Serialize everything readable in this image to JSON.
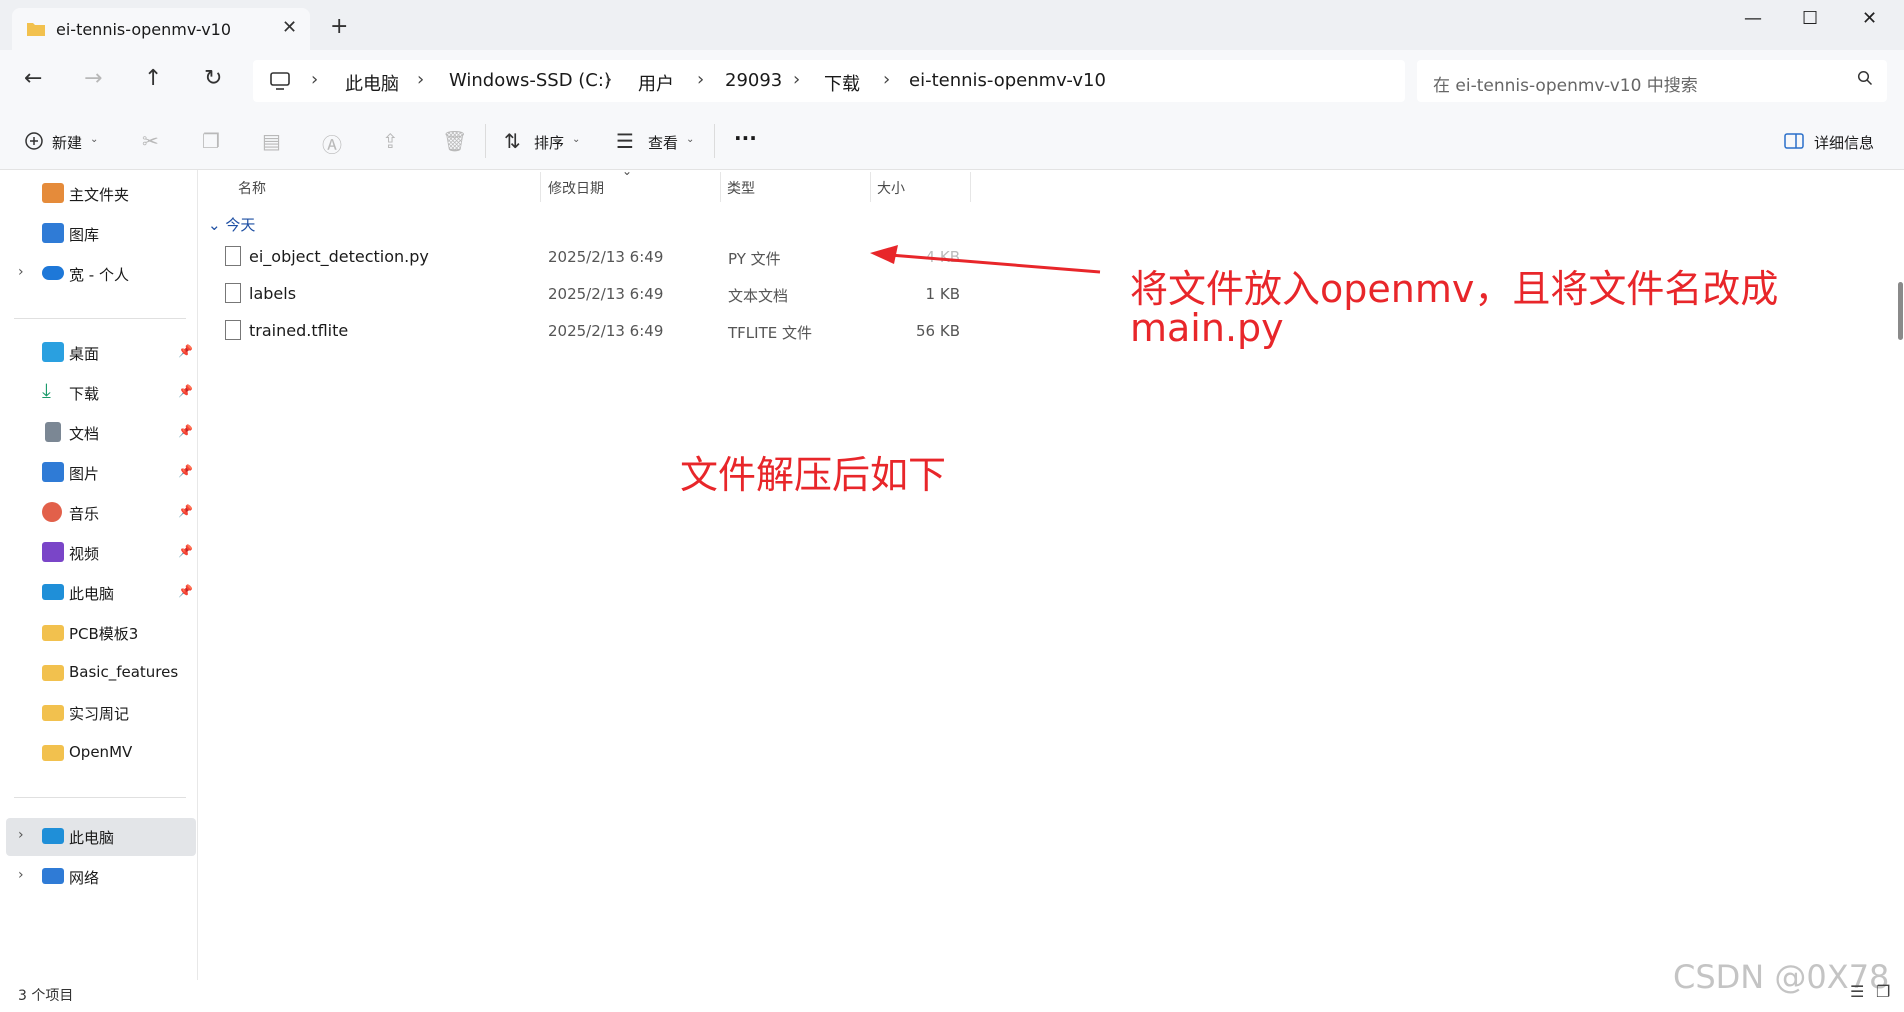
{
  "tab": {
    "title": "ei-tennis-openmv-v10",
    "close": "✕",
    "new": "+"
  },
  "window_controls": {
    "minimize": "—",
    "maximize": "☐",
    "close": "✕"
  },
  "nav": {
    "back": "←",
    "forward": "→",
    "up": "↑",
    "refresh": "↻"
  },
  "breadcrumb": [
    "此电脑",
    "Windows-SSD (C:)",
    "用户",
    "29093",
    "下载",
    "ei-tennis-openmv-v10"
  ],
  "breadcrumb_sep": "›",
  "search": {
    "placeholder": "在 ei-tennis-openmv-v10 中搜索"
  },
  "toolbar": {
    "new_label": "新建",
    "sort_label": "排序",
    "view_label": "查看",
    "more": "···",
    "details_label": "详细信息"
  },
  "sidebar": {
    "top": [
      {
        "label": "主文件夹",
        "icon": "home-icon",
        "color": "#e58b3a"
      },
      {
        "label": "图库",
        "icon": "gallery-icon",
        "color": "#2f7bd6"
      },
      {
        "label": "宽 - 个人",
        "icon": "cloud-icon",
        "color": "#1e78d8"
      }
    ],
    "quick": [
      {
        "label": "桌面",
        "icon": "desktop-icon",
        "color": "#2aa0e0"
      },
      {
        "label": "下载",
        "icon": "download-icon",
        "color": "#1a9a6a"
      },
      {
        "label": "文档",
        "icon": "document-icon",
        "color": "#7b8794"
      },
      {
        "label": "图片",
        "icon": "picture-icon",
        "color": "#2f7bd6"
      },
      {
        "label": "音乐",
        "icon": "music-icon",
        "color": "#e2604a"
      },
      {
        "label": "视频",
        "icon": "video-icon",
        "color": "#7a45c8"
      },
      {
        "label": "此电脑",
        "icon": "computer-icon",
        "color": "#1f8fd8"
      },
      {
        "label": "PCB模板3",
        "icon": "folder-icon",
        "color": "#f2c14e"
      },
      {
        "label": "Basic_features",
        "icon": "folder-icon",
        "color": "#f2c14e"
      },
      {
        "label": "实习周记",
        "icon": "folder-icon",
        "color": "#f2c14e"
      },
      {
        "label": "OpenMV",
        "icon": "folder-icon",
        "color": "#f2c14e"
      }
    ],
    "bottom": [
      {
        "label": "此电脑",
        "icon": "computer-icon",
        "color": "#1f8fd8"
      },
      {
        "label": "网络",
        "icon": "network-icon",
        "color": "#2f7bd6"
      }
    ]
  },
  "columns": {
    "name": "名称",
    "date": "修改日期",
    "type": "类型",
    "size": "大小"
  },
  "group_label": "今天",
  "files": [
    {
      "name": "ei_object_detection.py",
      "date": "2025/2/13 6:49",
      "type": "PY 文件",
      "size": "4 KB"
    },
    {
      "name": "labels",
      "date": "2025/2/13 6:49",
      "type": "文本文档",
      "size": "1 KB"
    },
    {
      "name": "trained.tflite",
      "date": "2025/2/13 6:49",
      "type": "TFLITE 文件",
      "size": "56 KB"
    }
  ],
  "annotations": {
    "note1_line1": "将文件放入openmv，且将文件名改成",
    "note1_line2": "main.py",
    "note2": "文件解压后如下"
  },
  "status": "3 个项目",
  "watermark": "CSDN @0X78"
}
